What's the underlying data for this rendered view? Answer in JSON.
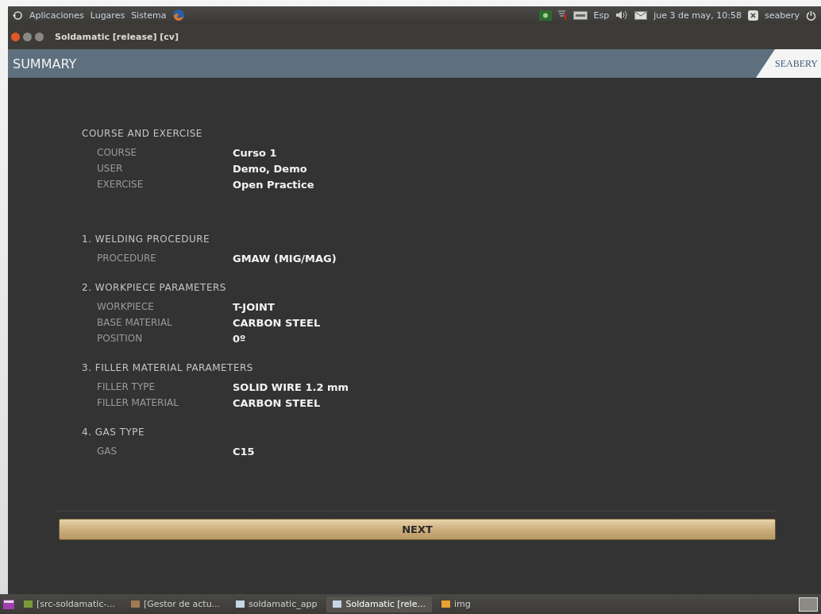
{
  "top_panel": {
    "menus": [
      "Aplicaciones",
      "Lugares",
      "Sistema"
    ],
    "keyboard": "Esp",
    "clock": "jue 3 de may, 10:58",
    "user": "seabery"
  },
  "window": {
    "title": "Soldamatic [release] [cv]"
  },
  "header": {
    "title": "SUMMARY",
    "logo": "SEABERY"
  },
  "sections": [
    {
      "title": "COURSE AND EXERCISE",
      "rows": [
        {
          "label": "COURSE",
          "value": "Curso 1"
        },
        {
          "label": "USER",
          "value": "Demo, Demo"
        },
        {
          "label": "EXERCISE",
          "value": "Open Practice"
        }
      ]
    },
    {
      "title": "1. WELDING PROCEDURE",
      "rows": [
        {
          "label": "PROCEDURE",
          "value": "GMAW (MIG/MAG)"
        }
      ]
    },
    {
      "title": "2. WORKPIECE PARAMETERS",
      "rows": [
        {
          "label": "WORKPIECE",
          "value": "T-JOINT"
        },
        {
          "label": "BASE MATERIAL",
          "value": "CARBON STEEL"
        },
        {
          "label": "POSITION",
          "value": "0º"
        }
      ]
    },
    {
      "title": "3. FILLER MATERIAL PARAMETERS",
      "rows": [
        {
          "label": "FILLER TYPE",
          "value": "SOLID WIRE 1.2 mm"
        },
        {
          "label": "FILLER MATERIAL",
          "value": "CARBON STEEL"
        }
      ]
    },
    {
      "title": "4. GAS TYPE",
      "rows": [
        {
          "label": "GAS",
          "value": "C15"
        }
      ]
    }
  ],
  "next_button": "NEXT",
  "taskbar": [
    {
      "label": "[src-soldamatic-...",
      "selected": false
    },
    {
      "label": "[Gestor de actu...",
      "selected": false
    },
    {
      "label": "soldamatic_app",
      "selected": false
    },
    {
      "label": "Soldamatic [rele...",
      "selected": true
    },
    {
      "label": "img",
      "selected": false
    }
  ]
}
